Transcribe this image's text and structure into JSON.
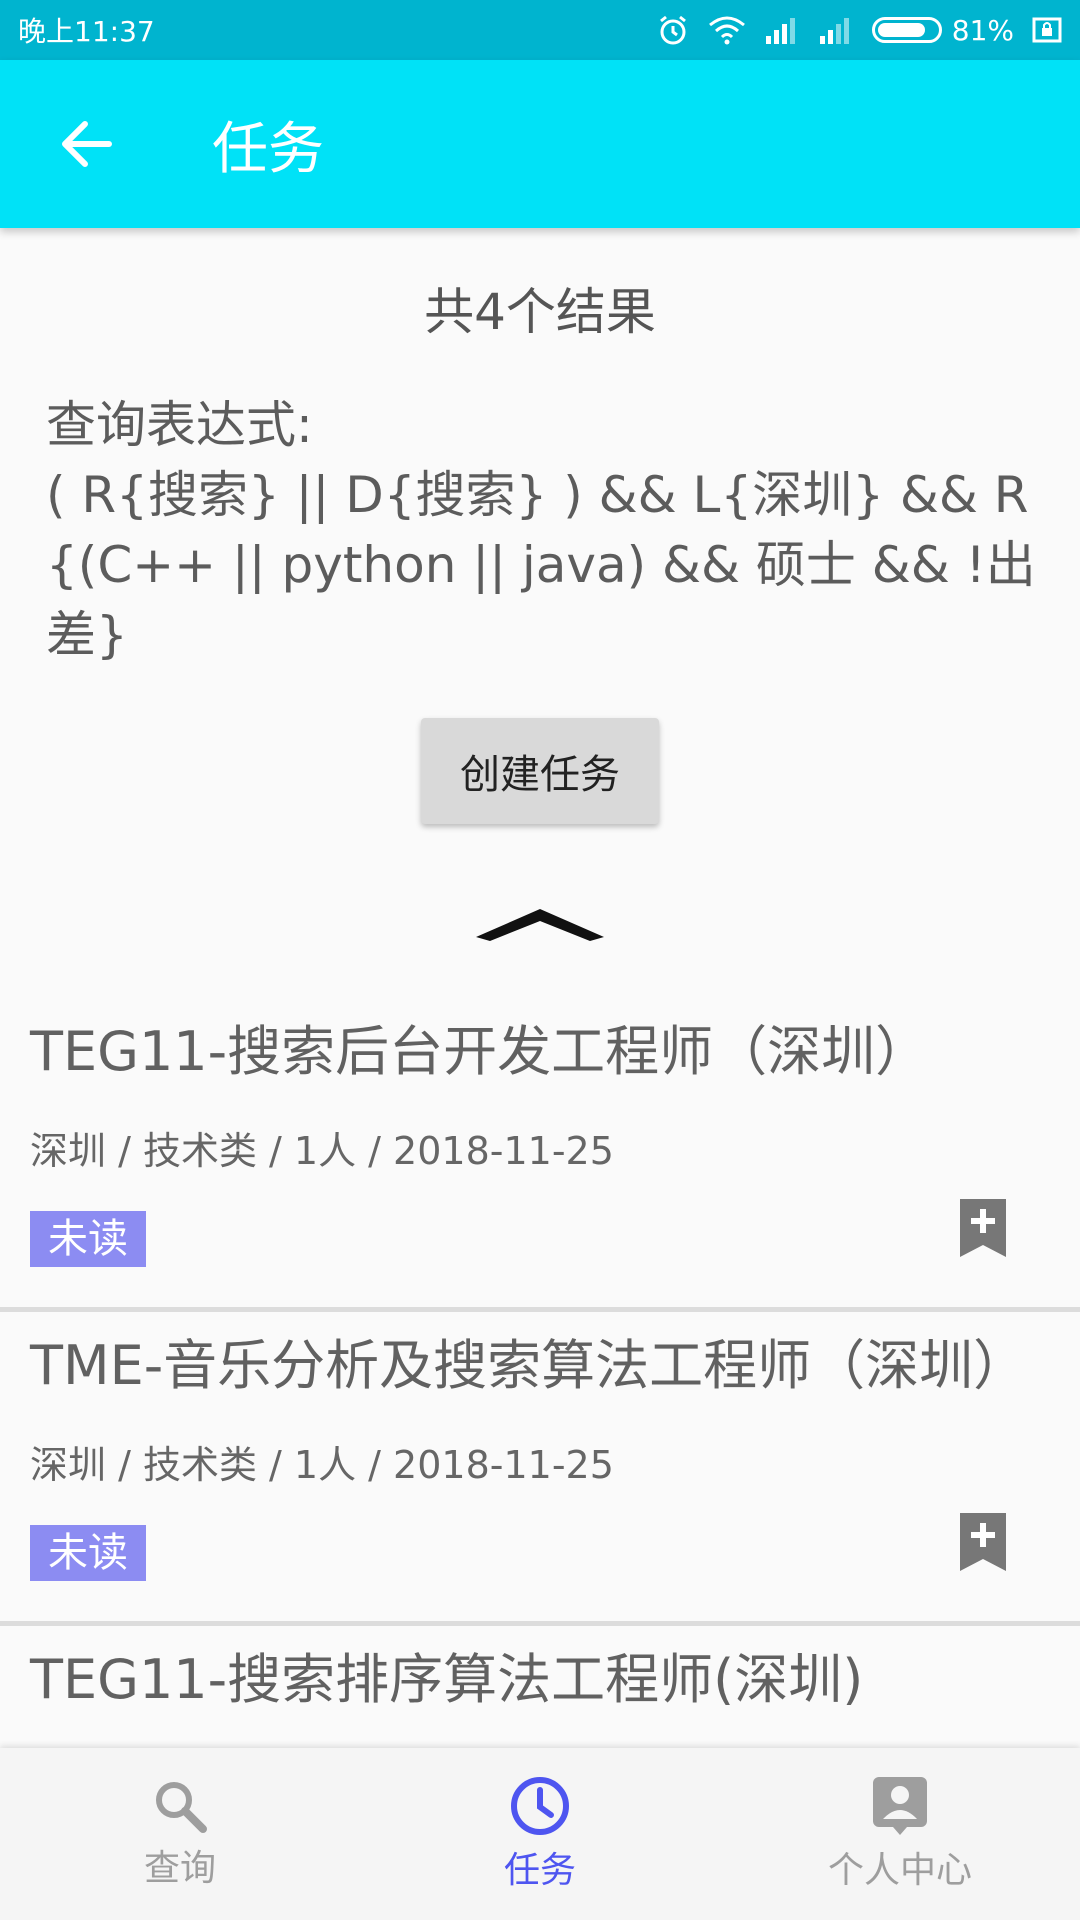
{
  "status_bar": {
    "time": "晚上11:37",
    "battery_percent": "81%",
    "battery_level": 0.81
  },
  "app_bar": {
    "title": "任务",
    "back_icon": "arrow-back-icon"
  },
  "summary": {
    "result_count": "共4个结果",
    "query_label": "查询表达式:",
    "query_expression": "( R{搜索} || D{搜索} ) && L{深圳} && R{(C++ || python || java) && 硕士 && !出差}"
  },
  "create_button_label": "创建任务",
  "jobs": [
    {
      "title": "TEG11-搜索后台开发工程师（深圳）",
      "meta": "深圳 / 技术类 / 1人 / 2018-11-25",
      "badge": "未读"
    },
    {
      "title": "TME-音乐分析及搜索算法工程师（深圳）",
      "meta": "深圳 / 技术类 / 1人 / 2018-11-25",
      "badge": "未读"
    },
    {
      "title": "TEG11-搜索排序算法工程师(深圳)",
      "meta": "",
      "badge": ""
    }
  ],
  "bottom_nav": {
    "items": [
      {
        "label": "查询",
        "icon": "search-icon",
        "active": false
      },
      {
        "label": "任务",
        "icon": "clock-icon",
        "active": true
      },
      {
        "label": "个人中心",
        "icon": "person-icon",
        "active": false
      }
    ]
  },
  "colors": {
    "status_bar": "#00b4cf",
    "app_bar": "#00e2f7",
    "badge": "#8c8cf2",
    "nav_active": "#4e55f0",
    "nav_inactive": "#9e9e9e"
  }
}
